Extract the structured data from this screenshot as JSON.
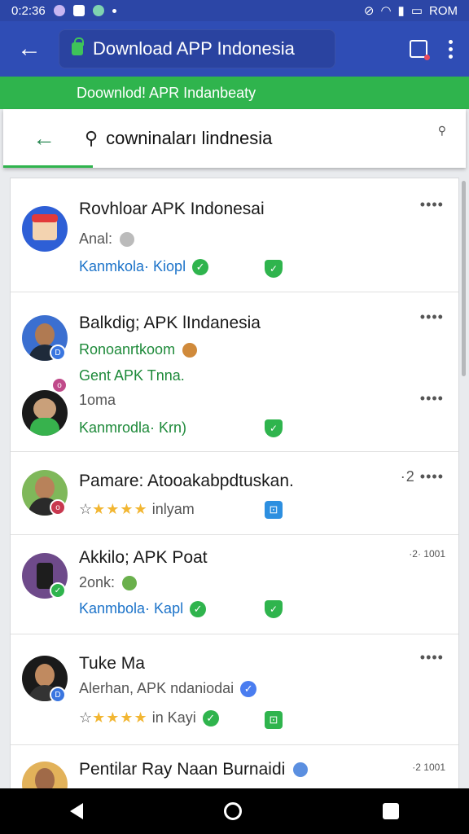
{
  "status": {
    "time": "0:2:36",
    "carrier": "ROM"
  },
  "browser": {
    "url_title": "Download APP Indonesia",
    "banner": "Doownlod! APR Indanbeaty"
  },
  "search": {
    "query": "cowninaları lindnesia"
  },
  "items": [
    {
      "title": "Rovhloar APK Indonesai",
      "line1": "Anal:",
      "line2": "Kanmkola· Kiopl"
    },
    {
      "title": "Balkdig; APK lIndanesia",
      "line1": "Ronoanrtkoom",
      "line2": "Gent APK Tnna."
    },
    {
      "title": "",
      "line1": "1oma",
      "line2": "Kanmrodla· Krn)"
    },
    {
      "title": "Pamare: Atooakabpdtuskan.",
      "line1": "inlyam",
      "line2": ""
    },
    {
      "title": "Akkilo; APK Poat",
      "line1": "2onk:",
      "line2": "Kanmbola· Kapl"
    },
    {
      "title": "Tuke Ma",
      "line1": "Alerhan, APK ndaniodai",
      "line2": "in Kayi"
    },
    {
      "title": "Pentilar Ray Naan Burnaidi",
      "line1": "",
      "line2": ""
    }
  ],
  "meta": {
    "more": "••••",
    "ver1": "·2 ••••",
    "ver2": "·2· 1001",
    "ver3": "·2 1001",
    "stars": "★★★★"
  },
  "colors": {
    "appbar": "#2f4db5",
    "accent": "#2fb44d",
    "link_blue": "#1c73c9"
  }
}
